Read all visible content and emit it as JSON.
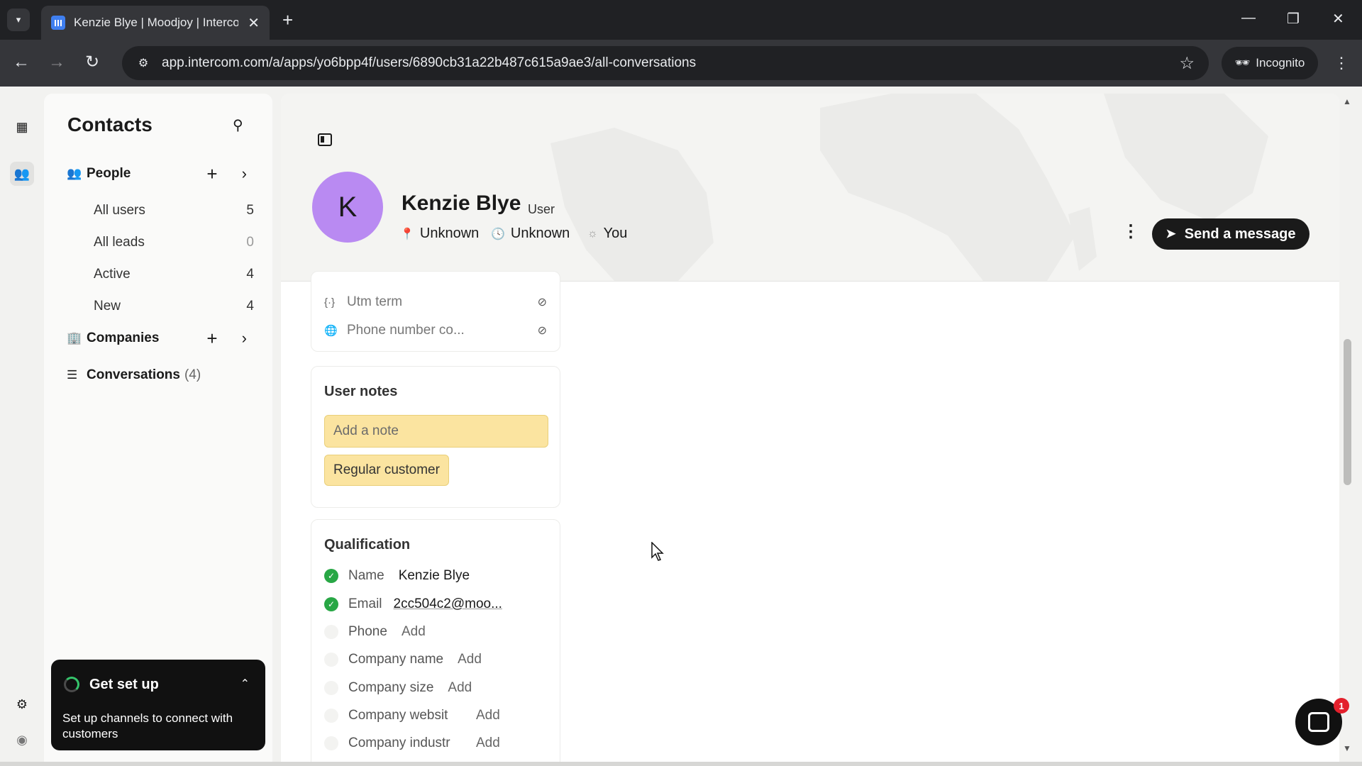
{
  "browser": {
    "tab_title": "Kenzie Blye | Moodjoy | Interco",
    "url": "app.intercom.com/a/apps/yo6bpp4f/users/6890cb31a22b487c615a9ae3/all-conversations",
    "incognito_label": "Incognito"
  },
  "sidebar": {
    "title": "Contacts",
    "people": {
      "label": "People",
      "items": [
        {
          "label": "All users",
          "count": "5"
        },
        {
          "label": "All leads",
          "count": "0"
        },
        {
          "label": "Active",
          "count": "4"
        },
        {
          "label": "New",
          "count": "4"
        }
      ]
    },
    "companies_label": "Companies",
    "conversations_label": "Conversations",
    "conversations_count": "(4)"
  },
  "setup_card": {
    "title": "Get set up",
    "text": "Set up channels to connect with customers"
  },
  "contact": {
    "initial": "K",
    "name": "Kenzie Blye",
    "role": "User",
    "location": "Unknown",
    "local_time": "Unknown",
    "owner": "You",
    "send_button": "Send a message"
  },
  "attributes": [
    {
      "label": "Utm term",
      "icon": "code-brackets-icon"
    },
    {
      "label": "Phone number co...",
      "icon": "globe-icon"
    }
  ],
  "user_notes": {
    "title": "User notes",
    "placeholder": "Add a note",
    "tag": "Regular customer"
  },
  "qualification": {
    "title": "Qualification",
    "add_label": "Add",
    "rows": [
      {
        "label": "Name",
        "value": "Kenzie Blye",
        "complete": true
      },
      {
        "label": "Email",
        "value": "2cc504c2@moo...",
        "complete": true
      },
      {
        "label": "Phone",
        "value": "",
        "complete": false
      },
      {
        "label": "Company name",
        "value": "",
        "complete": false
      },
      {
        "label": "Company size",
        "value": "",
        "complete": false
      },
      {
        "label": "Company websit",
        "value": "",
        "complete": false
      },
      {
        "label": "Company industr",
        "value": "",
        "complete": false
      }
    ]
  },
  "messenger": {
    "badge_count": "1"
  },
  "colors": {
    "avatar": "#b98af2",
    "note_background": "#fbe4a0",
    "check_complete": "#28a745",
    "badge": "#e3202c"
  }
}
